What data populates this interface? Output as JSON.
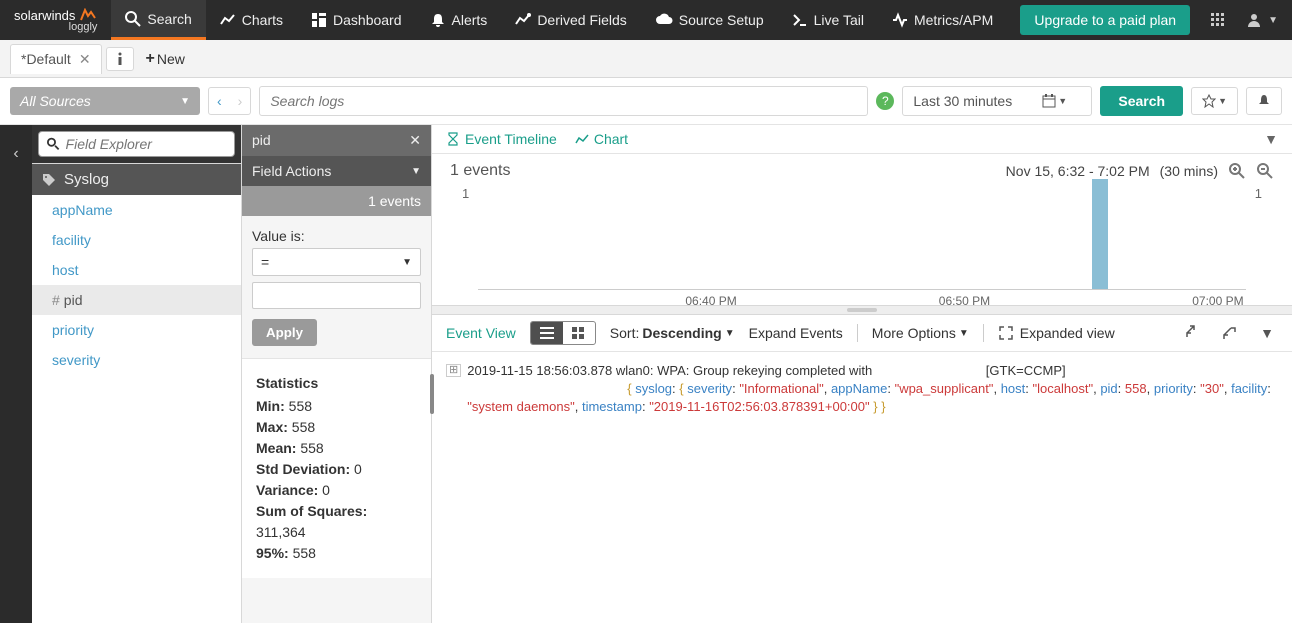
{
  "brand": {
    "main": "solarwinds",
    "sub": "loggly"
  },
  "nav": {
    "search": "Search",
    "charts": "Charts",
    "dashboard": "Dashboard",
    "alerts": "Alerts",
    "derived": "Derived Fields",
    "source": "Source Setup",
    "livetail": "Live Tail",
    "metrics": "Metrics/APM",
    "upgrade": "Upgrade to a paid plan"
  },
  "tabs": {
    "default": "*Default",
    "new": "New"
  },
  "searchbar": {
    "sources": "All Sources",
    "placeholder": "Search logs",
    "timerange": "Last 30 minutes",
    "search_btn": "Search"
  },
  "field_explorer": {
    "placeholder": "Field Explorer",
    "group": "Syslog",
    "fields": {
      "appName": "appName",
      "facility": "facility",
      "host": "host",
      "pid": "pid",
      "priority": "priority",
      "severity": "severity"
    }
  },
  "filter_panel": {
    "title": "pid",
    "actions": "Field Actions",
    "count": "1 events",
    "value_is": "Value is:",
    "operator": "=",
    "apply": "Apply"
  },
  "stats": {
    "title": "Statistics",
    "min_l": "Min:",
    "min_v": "558",
    "max_l": "Max:",
    "max_v": "558",
    "mean_l": "Mean:",
    "mean_v": "558",
    "std_l": "Std Deviation:",
    "std_v": "0",
    "var_l": "Variance:",
    "var_v": "0",
    "sos_l": "Sum of Squares:",
    "sos_v": "311,364",
    "p95_l": "95%:",
    "p95_v": "558"
  },
  "timeline": {
    "tab_timeline": "Event Timeline",
    "tab_chart": "Chart",
    "summary": "1 events",
    "range": "Nov 15, 6:32 - 7:02 PM",
    "duration": "(30 mins)",
    "y_left": "1",
    "y_right": "1",
    "x_ticks": {
      "t1": "06:40 PM",
      "t2": "06:50 PM",
      "t3": "07:00 PM"
    }
  },
  "events_bar": {
    "event_view": "Event View",
    "sort_l": "Sort:",
    "sort_v": "Descending",
    "expand_events": "Expand Events",
    "more_options": "More Options",
    "expanded_view": "Expanded view"
  },
  "log": {
    "ts": "2019-11-15 18:56:03.878",
    "msg": "wlan0: WPA: Group rekeying completed with ",
    "gtk": "[GTK=CCMP]",
    "k_syslog": "syslog",
    "k_severity": "severity",
    "v_severity": "\"Informational\"",
    "k_appName": "appName",
    "v_appName": "\"wpa_supplicant\"",
    "k_host": "host",
    "v_host": "\"localhost\"",
    "k_pid": "pid",
    "v_pid": "558",
    "k_priority": "priority",
    "v_priority": "\"30\"",
    "k_facility": "facility",
    "v_facility": "\"system daemons\"",
    "k_timestamp": "timestamp",
    "v_timestamp": "\"2019-11-16T02:56:03.878391+00:00\""
  },
  "chart_data": {
    "type": "bar",
    "title": "Event Timeline",
    "categories": [
      "06:40 PM",
      "06:50 PM",
      "07:00 PM"
    ],
    "bars": [
      {
        "time_approx": "06:56 PM",
        "count": 1
      }
    ],
    "ylim": [
      0,
      1
    ],
    "xrange": "Nov 15, 6:32 - 7:02 PM",
    "duration_mins": 30,
    "total_events": 1
  }
}
